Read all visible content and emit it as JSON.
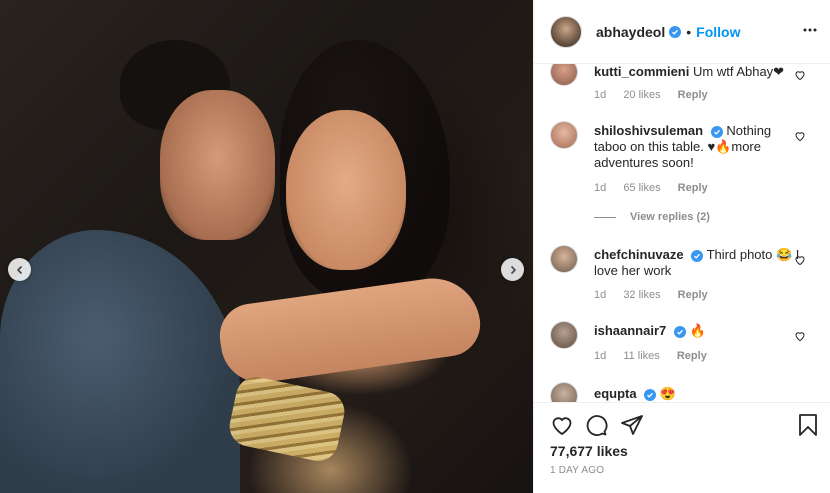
{
  "post": {
    "username": "abhaydeol",
    "follow_label": "Follow",
    "separator": "•",
    "likes": "77,677 likes",
    "time_ago": "1 DAY AGO"
  },
  "comments": [
    {
      "user": "kutti_commieni",
      "text": "Um wtf Abhay❤",
      "age": "1d",
      "likes": "20 likes",
      "reply": "Reply",
      "verified": false
    },
    {
      "user": "shiloshivsuleman",
      "text": "Nothing taboo on this table. ♥🔥more adventures soon!",
      "age": "1d",
      "likes": "65 likes",
      "reply": "Reply",
      "verified": true,
      "view_replies": "View replies (2)"
    },
    {
      "user": "chefchinuvaze",
      "text": "Third photo 😂 I love her work",
      "age": "1d",
      "likes": "32 likes",
      "reply": "Reply",
      "verified": true
    },
    {
      "user": "ishaannair7",
      "text": "🔥",
      "age": "1d",
      "likes": "11 likes",
      "reply": "Reply",
      "verified": true
    },
    {
      "user": "equpta",
      "text": "😍",
      "verified": true
    }
  ],
  "colors": {
    "accent": "#0095f6",
    "verified": "#3897f0",
    "muted": "#8e8e8e",
    "heart": "#c4002b"
  },
  "icons": [
    "chevron-left-icon",
    "chevron-right-icon",
    "more-icon",
    "heart-icon",
    "comment-icon",
    "share-icon",
    "bookmark-icon",
    "verified-icon"
  ]
}
